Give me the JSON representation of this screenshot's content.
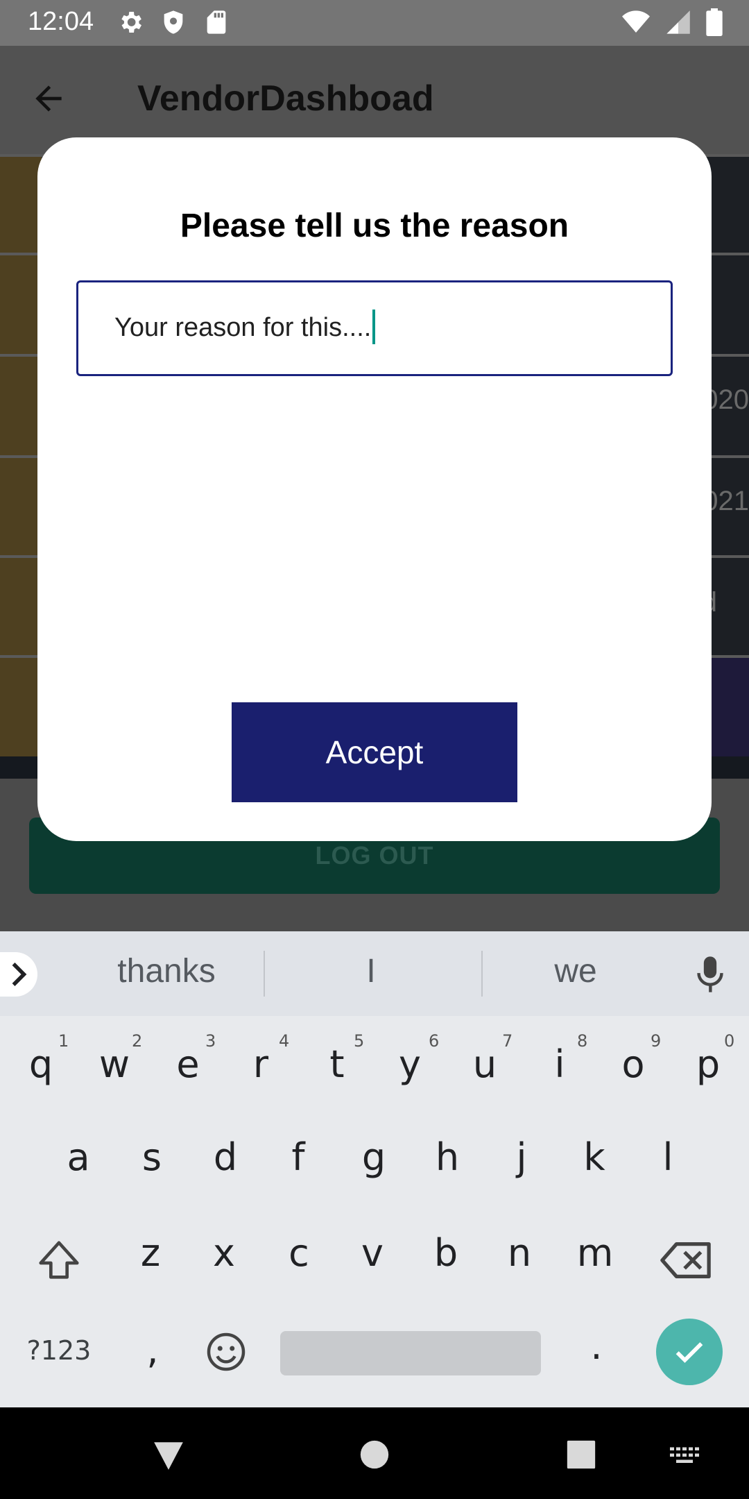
{
  "status_bar": {
    "time": "12:04",
    "left_icons": [
      "gear-icon",
      "shield-icon",
      "sd-card-icon"
    ],
    "right_icons": [
      "wifi-icon",
      "signal-icon",
      "battery-icon"
    ]
  },
  "app": {
    "title": "VendorDashboad",
    "grid_fragments": [
      "020",
      "021",
      "d"
    ],
    "logout_label": "LOG OUT"
  },
  "dialog": {
    "title": "Please tell us the reason",
    "reason_value": "Your reason for this....",
    "accept_label": "Accept"
  },
  "keyboard": {
    "suggestions": [
      "thanks",
      "I",
      "we"
    ],
    "row1": [
      {
        "k": "q",
        "n": "1"
      },
      {
        "k": "w",
        "n": "2"
      },
      {
        "k": "e",
        "n": "3"
      },
      {
        "k": "r",
        "n": "4"
      },
      {
        "k": "t",
        "n": "5"
      },
      {
        "k": "y",
        "n": "6"
      },
      {
        "k": "u",
        "n": "7"
      },
      {
        "k": "i",
        "n": "8"
      },
      {
        "k": "o",
        "n": "9"
      },
      {
        "k": "p",
        "n": "0"
      }
    ],
    "row2": [
      "a",
      "s",
      "d",
      "f",
      "g",
      "h",
      "j",
      "k",
      "l"
    ],
    "row3": [
      "z",
      "x",
      "c",
      "v",
      "b",
      "n",
      "m"
    ],
    "symbols_label": "?123",
    "comma": ",",
    "period": "."
  },
  "colors": {
    "dialog_border": "#1a237e",
    "accept_bg": "#1a1f6e",
    "cursor": "#009688",
    "enter_key": "#4db6ac",
    "logout_bg": "#0b3b30"
  }
}
